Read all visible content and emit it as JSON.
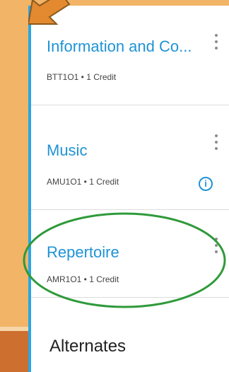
{
  "courses": [
    {
      "title": "Information and Co...",
      "meta": "BTT1O1 • 1 Credit"
    },
    {
      "title": "Music",
      "meta": "AMU1O1 • 1 Credit"
    },
    {
      "title": "Repertoire",
      "meta": "AMR1O1 • 1 Credit"
    }
  ],
  "alternates_label": "Alternates",
  "colors": {
    "accent": "#1f93d6",
    "background": "#f2b467",
    "highlight": "#2e9a3a",
    "arrow": "#e3892f"
  },
  "icons": {
    "menu": "kebab-icon",
    "info": "info-icon"
  }
}
